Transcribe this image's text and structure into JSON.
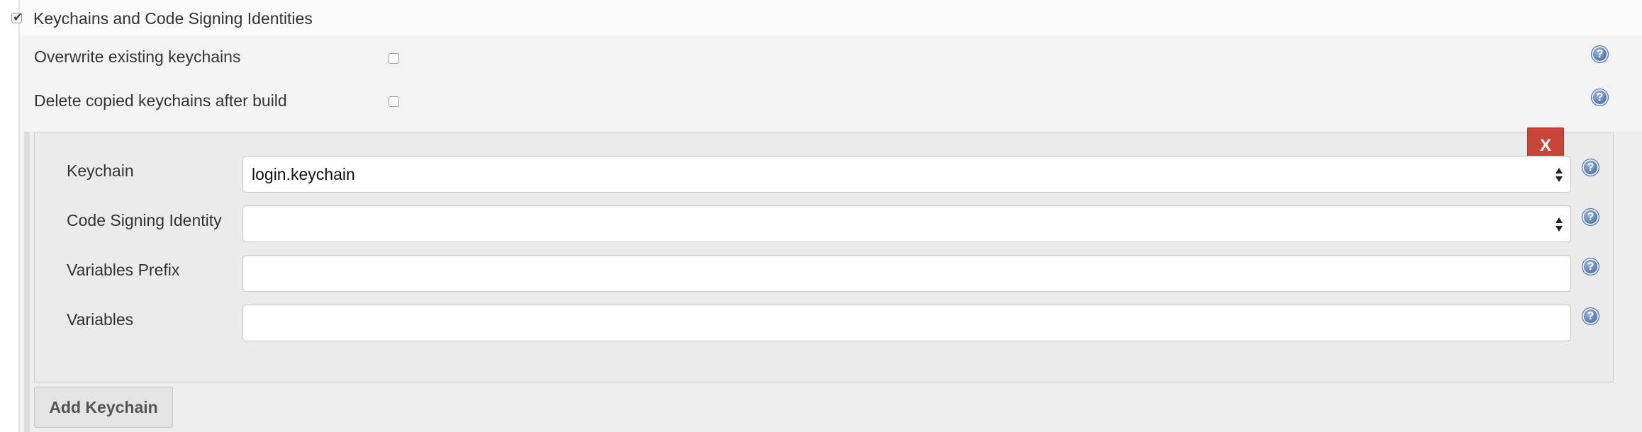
{
  "section": {
    "title": "Keychains and Code Signing Identities",
    "enabled": true
  },
  "options": [
    {
      "label": "Overwrite existing keychains",
      "checked": false
    },
    {
      "label": "Delete copied keychains after build",
      "checked": false
    }
  ],
  "keychain_entry": {
    "delete_label": "X",
    "keychain": {
      "label": "Keychain",
      "value": "login.keychain"
    },
    "code_signing_identity": {
      "label": "Code Signing Identity",
      "value": ""
    },
    "variables_prefix": {
      "label": "Variables Prefix",
      "value": ""
    },
    "variables": {
      "label": "Variables",
      "value": ""
    }
  },
  "add_button_label": "Add Keychain",
  "help_glyph": "?",
  "icons": {
    "help": "help-icon",
    "select": "select-arrows-icon",
    "check": "checkmark-icon"
  },
  "colors": {
    "delete_button": "#c9453a",
    "help_icon": "#5d7fb2",
    "panel_background": "#f3f3f3"
  }
}
